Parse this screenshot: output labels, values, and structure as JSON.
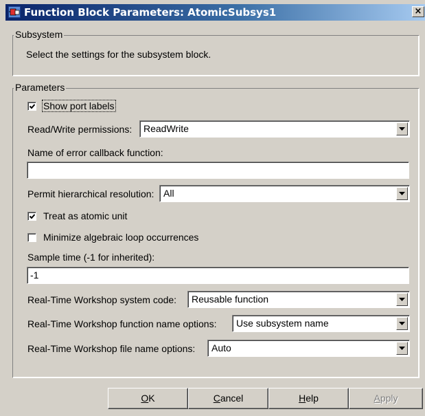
{
  "window": {
    "title": "Function Block Parameters: AtomicSubsys1",
    "close_glyph": "×"
  },
  "subsystem_group": {
    "legend": "Subsystem",
    "description": "Select the settings for the subsystem block."
  },
  "parameters_group": {
    "legend": "Parameters",
    "show_port_labels": {
      "label": "Show port labels",
      "checked": true
    },
    "read_write": {
      "label": "Read/Write permissions:",
      "value": "ReadWrite"
    },
    "error_callback": {
      "label": "Name of error callback function:",
      "value": ""
    },
    "hierarchical_resolution": {
      "label": "Permit hierarchical resolution:",
      "value": "All"
    },
    "treat_atomic": {
      "label": "Treat as atomic unit",
      "checked": true
    },
    "minimize_loop": {
      "label": "Minimize algebraic loop occurrences",
      "checked": false
    },
    "sample_time": {
      "label": "Sample time (-1 for inherited):",
      "value": "-1"
    },
    "rtw_system_code": {
      "label": "Real-Time Workshop system code:",
      "value": "Reusable function"
    },
    "rtw_function_name": {
      "label": "Real-Time Workshop function name options:",
      "value": "Use subsystem name"
    },
    "rtw_file_name": {
      "label": "Real-Time Workshop file name options:",
      "value": "Auto"
    }
  },
  "buttons": {
    "ok": {
      "mnemonic": "O",
      "rest": "K"
    },
    "cancel": {
      "mnemonic": "C",
      "rest": "ancel"
    },
    "help": {
      "mnemonic": "H",
      "rest": "elp"
    },
    "apply": {
      "mnemonic": "A",
      "rest": "pply",
      "disabled": true
    }
  },
  "icons": {
    "app": "simulink-block-icon",
    "close": "close-icon",
    "check": "check-icon",
    "dropdown": "chevron-down-icon"
  },
  "colors": {
    "dialog_face": "#d4d0c8",
    "title_start": "#0a246a",
    "title_end": "#a6caf0",
    "disabled_text": "#808080"
  }
}
